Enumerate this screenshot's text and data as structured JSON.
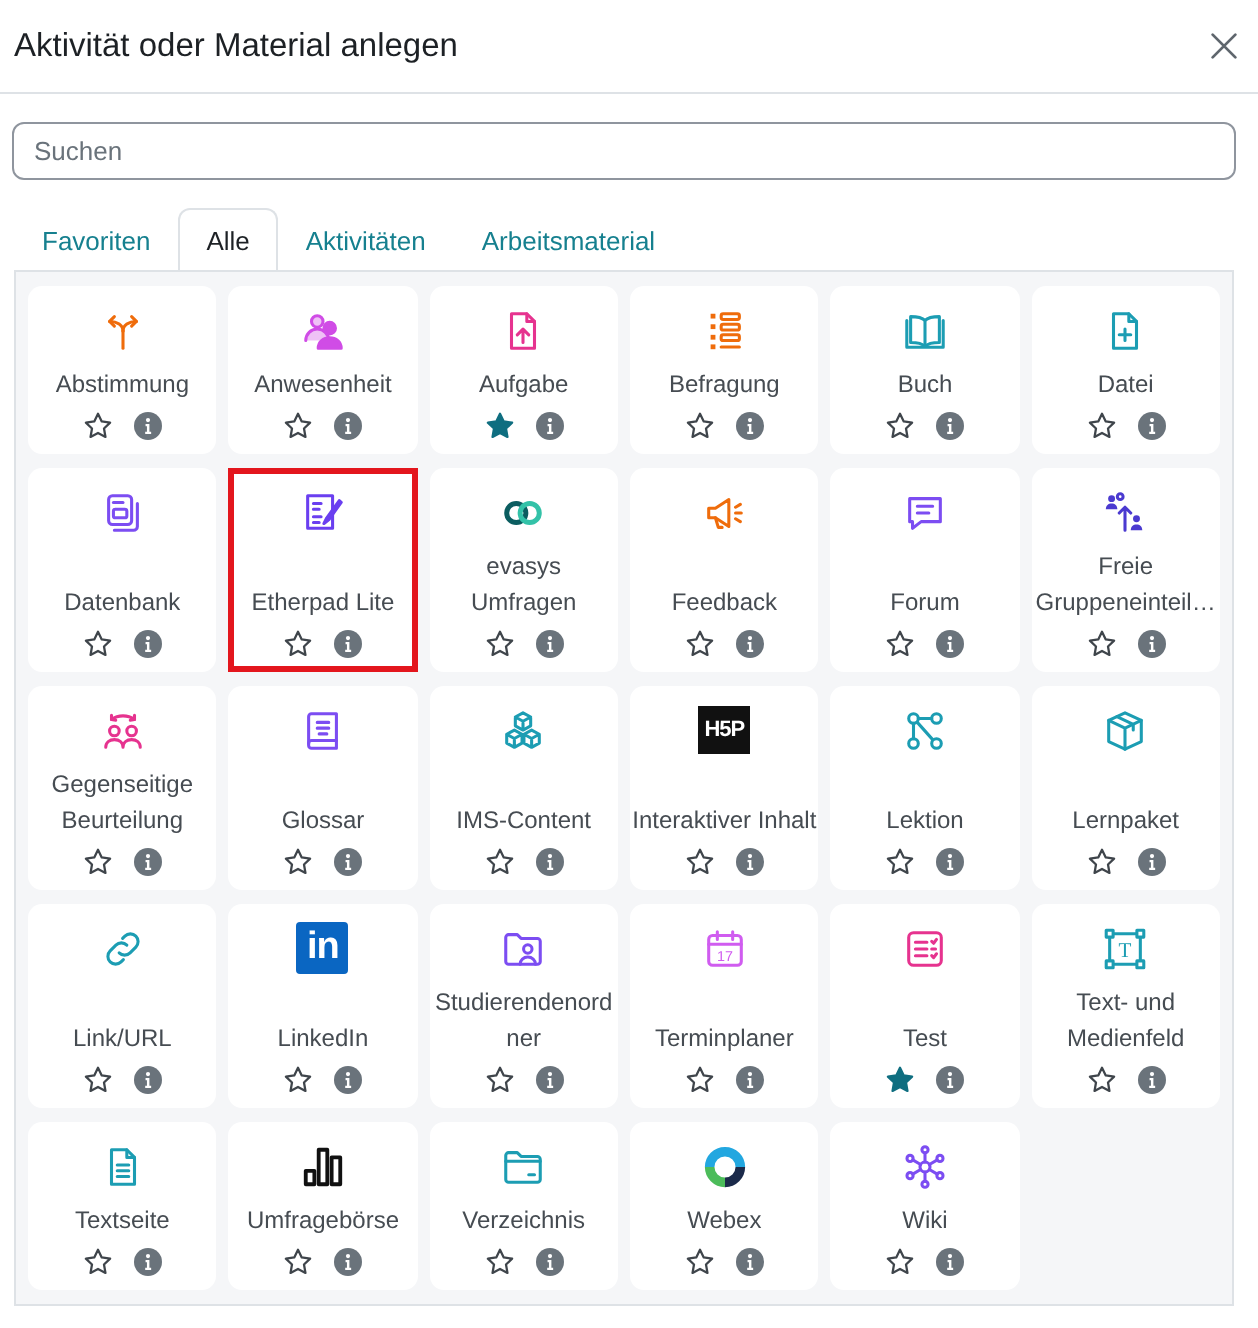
{
  "dialog": {
    "title": "Aktivität oder Material anlegen"
  },
  "search": {
    "placeholder": "Suchen"
  },
  "tabs": [
    {
      "label": "Favoriten",
      "selected": false
    },
    {
      "label": "Alle",
      "selected": true
    },
    {
      "label": "Aktivitäten",
      "selected": false
    },
    {
      "label": "Arbeitsmaterial",
      "selected": false
    }
  ],
  "items": [
    {
      "kind": "choice",
      "name": "Abstimmung",
      "favorite": false,
      "highlighted": false
    },
    {
      "kind": "attendance",
      "name": "Anwesenheit",
      "favorite": false,
      "highlighted": false
    },
    {
      "kind": "assign",
      "name": "Aufgabe",
      "favorite": true,
      "highlighted": false
    },
    {
      "kind": "questionnaire",
      "name": "Befragung",
      "favorite": false,
      "highlighted": false
    },
    {
      "kind": "book",
      "name": "Buch",
      "favorite": false,
      "highlighted": false
    },
    {
      "kind": "resource",
      "name": "Datei",
      "favorite": false,
      "highlighted": false
    },
    {
      "kind": "data",
      "name": "Datenbank",
      "favorite": false,
      "highlighted": false
    },
    {
      "kind": "etherpad",
      "name": "Etherpad Lite",
      "favorite": false,
      "highlighted": true
    },
    {
      "kind": "evasys",
      "name": "evasys Umfragen",
      "favorite": false,
      "highlighted": false
    },
    {
      "kind": "feedback",
      "name": "Feedback",
      "favorite": false,
      "highlighted": false
    },
    {
      "kind": "forum",
      "name": "Forum",
      "favorite": false,
      "highlighted": false
    },
    {
      "kind": "groupselect",
      "name": "Freie Gruppeneinteil…",
      "favorite": false,
      "highlighted": false
    },
    {
      "kind": "workshop",
      "name": "Gegenseitige Beurteilung",
      "favorite": false,
      "highlighted": false
    },
    {
      "kind": "glossary",
      "name": "Glossar",
      "favorite": false,
      "highlighted": false
    },
    {
      "kind": "imscp",
      "name": "IMS-Content",
      "favorite": false,
      "highlighted": false
    },
    {
      "kind": "h5p",
      "icon_text": "H5P",
      "name": "Interaktiver Inhalt",
      "favorite": false,
      "highlighted": false
    },
    {
      "kind": "lesson",
      "name": "Lektion",
      "favorite": false,
      "highlighted": false
    },
    {
      "kind": "scorm",
      "name": "Lernpaket",
      "favorite": false,
      "highlighted": false
    },
    {
      "kind": "url",
      "name": "Link/URL",
      "favorite": false,
      "highlighted": false
    },
    {
      "kind": "linkedin",
      "icon_text": "in",
      "name": "LinkedIn",
      "favorite": false,
      "highlighted": false
    },
    {
      "kind": "studentfolder",
      "name": "Studierendenordner",
      "favorite": false,
      "highlighted": false
    },
    {
      "kind": "scheduler",
      "icon_text": "17",
      "name": "Terminplaner",
      "favorite": false,
      "highlighted": false
    },
    {
      "kind": "quiz",
      "name": "Test",
      "favorite": true,
      "highlighted": false
    },
    {
      "kind": "label",
      "icon_text": "T",
      "name": "Text- und Medienfeld",
      "favorite": false,
      "highlighted": false
    },
    {
      "kind": "page",
      "name": "Textseite",
      "favorite": false,
      "highlighted": false
    },
    {
      "kind": "survey",
      "name": "Umfragebörse",
      "favorite": false,
      "highlighted": false
    },
    {
      "kind": "folder",
      "name": "Verzeichnis",
      "favorite": false,
      "highlighted": false
    },
    {
      "kind": "webex",
      "name": "Webex",
      "favorite": false,
      "highlighted": false
    },
    {
      "kind": "wiki",
      "name": "Wiki",
      "favorite": false,
      "highlighted": false
    }
  ]
}
